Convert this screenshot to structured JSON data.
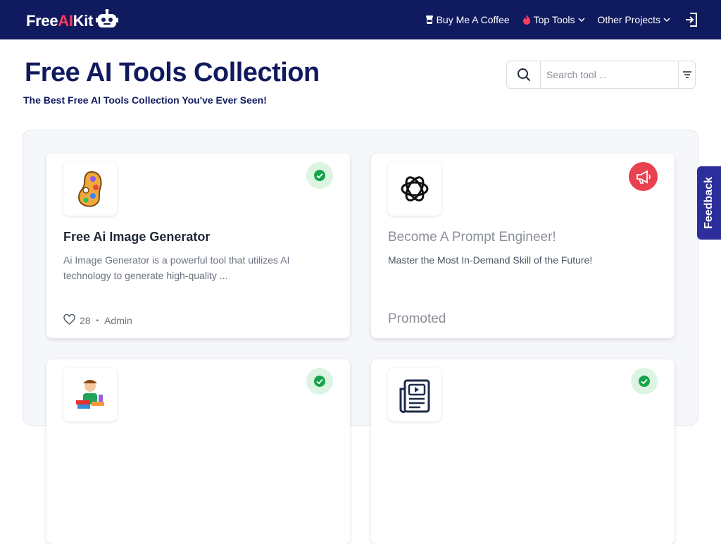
{
  "brand": {
    "free": "Free",
    "ai": "AI",
    "kit": "Kit"
  },
  "nav": {
    "coffee": "Buy Me A Coffee",
    "top_tools": "Top Tools",
    "other_projects": "Other Projects"
  },
  "header": {
    "title": "Free AI Tools Collection",
    "subtitle": "The Best Free AI Tools Collection You've Ever Seen!"
  },
  "search": {
    "placeholder": "Search tool ..."
  },
  "cards": [
    {
      "title": "Free Ai Image Generator",
      "description": "Ai Image Generator is a powerful tool that utilizes AI technology to generate high-quality ...",
      "likes": "28",
      "separator": "•",
      "author": "Admin",
      "icon": "paint-palette-icon",
      "badge": "verified-icon"
    },
    {
      "title": "Become A Prompt Engineer!",
      "description": "Master the Most In-Demand Skill of the Future!",
      "label": "Promoted",
      "icon": "openai-logo-icon",
      "badge": "megaphone-icon"
    },
    {
      "icon": "books-kid-icon",
      "badge": "verified-icon"
    },
    {
      "icon": "article-video-icon",
      "badge": "verified-icon"
    }
  ],
  "feedback": "Feedback",
  "colors": {
    "navy": "#101a5e",
    "accent": "#ff3b5c",
    "promo": "#e8414f",
    "verify_bg": "#dcf5e3",
    "verify": "#16a34a",
    "feedback": "#2d2e9c"
  }
}
